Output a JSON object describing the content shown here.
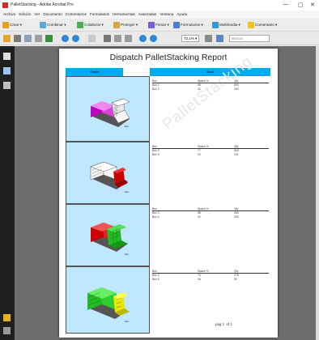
{
  "window": {
    "title": "PalletStacking - Adobe Acrobat Pro",
    "minimize": "—",
    "maximize": "▢",
    "close": "✕"
  },
  "menu": [
    "Archivo",
    "Edición",
    "Ver",
    "Documento",
    "Comentarios",
    "Formularios",
    "Herramientas",
    "Avanzadas",
    "Ventana",
    "Ayuda"
  ],
  "toolbar1": {
    "crear": "Crear ▾",
    "combinar": "Combinar ▾",
    "colaborar": "Colaborar ▾",
    "proteger": "Proteger ▾",
    "firmar": "Firmar ▾",
    "formularios": "Formularios ▾",
    "multimedia": "Multimedia ▾",
    "comentario": "Comentario ▾"
  },
  "toolbar2": {
    "zoom": "72,1% ▾",
    "search_placeholder": "Buscar"
  },
  "report": {
    "title": "Dispatch PalletStacking Report",
    "header_left": "Graph",
    "header_right": "Stack",
    "col_box": "Box",
    "col_space": "Space %",
    "col_qty": "Qty",
    "watermark": "PalletStacking",
    "page_label": "pag",
    "page_num": "1",
    "page_of": "of 1",
    "sections": [
      {
        "rows": [
          [
            "Box 1",
            "95",
            "600"
          ],
          [
            "Box 2",
            "42",
            "162"
          ]
        ]
      },
      {
        "rows": [
          [
            "Box 2",
            "77",
            "316"
          ],
          [
            "Box 3",
            "23",
            "231"
          ]
        ]
      },
      {
        "rows": [
          [
            "Box 3",
            "58",
            "400"
          ],
          [
            "Box 4",
            "42",
            "240"
          ]
        ]
      },
      {
        "rows": [
          [
            "Box 4",
            "74",
            "378"
          ],
          [
            "Box 5",
            "26",
            "90"
          ]
        ]
      }
    ]
  },
  "colors": {
    "accent_header": "#00aaee",
    "graph_bg": "#bfe7ff",
    "magenta": "#c000c0",
    "red": "#cc0000",
    "green": "#22bb22",
    "yellow": "#e8e800",
    "white_box": "#f0f0f0"
  }
}
